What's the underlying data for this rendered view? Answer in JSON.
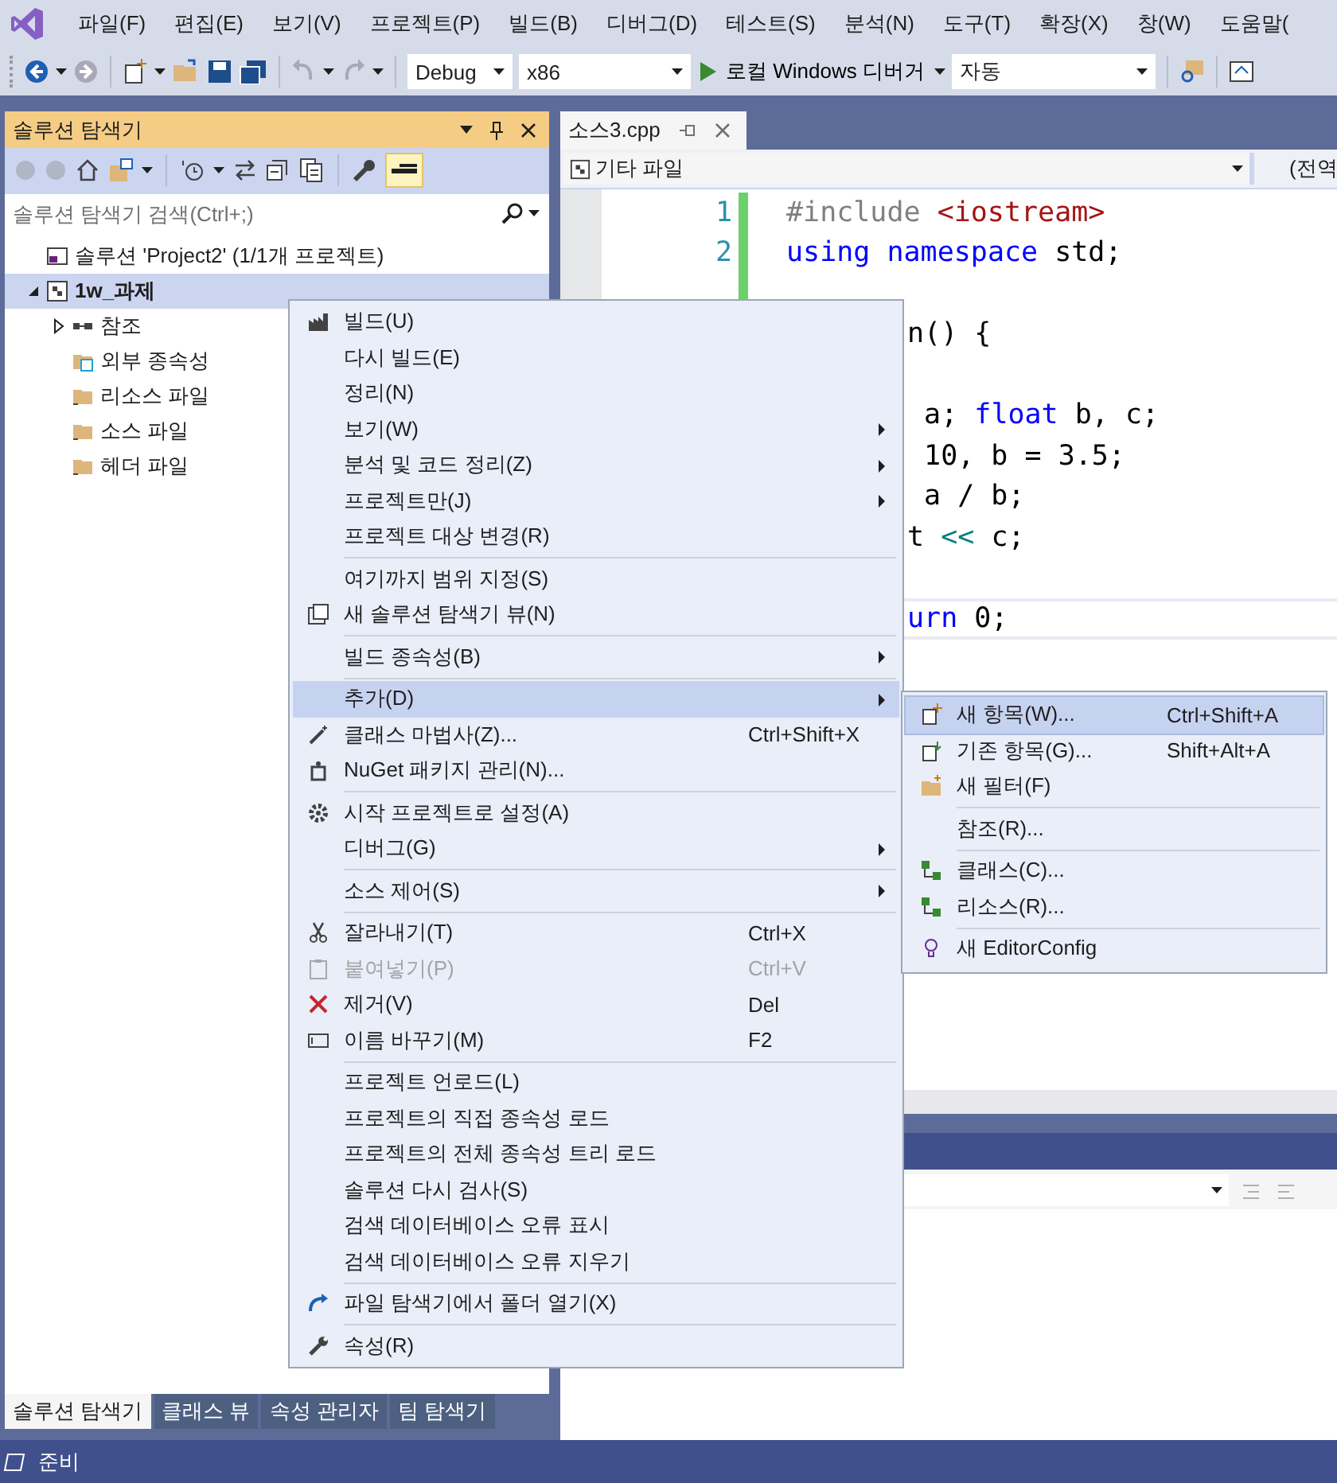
{
  "menu_bar": {
    "items": [
      "파일(F)",
      "편집(E)",
      "보기(V)",
      "프로젝트(P)",
      "빌드(B)",
      "디버그(D)",
      "테스트(S)",
      "분석(N)",
      "도구(T)",
      "확장(X)",
      "창(W)",
      "도움말("
    ]
  },
  "toolbar": {
    "configuration": "Debug",
    "platform": "x86",
    "debugger": "로컬 Windows 디버거",
    "target": "자동"
  },
  "solution_explorer": {
    "title": "솔루션 탐색기",
    "search": {
      "placeholder": "솔루션 탐색기 검색(Ctrl+;)"
    },
    "tree": [
      {
        "label": "솔루션 'Project2' (1/1개 프로젝트)",
        "selected": false,
        "children": [
          {
            "label": "1w_과제",
            "selected": true,
            "expanded": true,
            "children": [
              {
                "label": "참조",
                "selected": false,
                "expanded": false
              },
              {
                "label": "외부 종속성",
                "selected": false
              },
              {
                "label": "리소스 파일",
                "selected": false
              },
              {
                "label": "소스 파일",
                "selected": false
              },
              {
                "label": "헤더 파일",
                "selected": false
              }
            ]
          }
        ]
      }
    ],
    "bottom_tabs": [
      {
        "label": "솔루션 탐색기",
        "selected": true
      },
      {
        "label": "클래스 뷰",
        "selected": false
      },
      {
        "label": "속성 관리자",
        "selected": false
      },
      {
        "label": "팀 탐색기",
        "selected": false
      }
    ]
  },
  "editor": {
    "tabs": [
      {
        "label": "소스3.cpp",
        "selected": true
      }
    ],
    "nav": {
      "scope": "기타 파일",
      "member": "(전역"
    },
    "lines": [
      {
        "number": "1",
        "changed": true,
        "current": false,
        "tokens": [
          {
            "text": "#include ",
            "kind": "preprocessor"
          },
          {
            "text": "<iostream>",
            "kind": "string"
          }
        ]
      },
      {
        "number": "2",
        "changed": true,
        "current": false,
        "tokens": [
          {
            "text": "using",
            "kind": "keyword"
          },
          {
            "text": " namespace",
            "kind": "keyword"
          },
          {
            "text": " std;",
            "kind": "plain"
          }
        ]
      },
      {
        "changed": true,
        "current": false
      },
      {
        "current": false,
        "tokens": [
          {
            "text": "n() {",
            "kind": "plain"
          }
        ]
      },
      {
        "current": false
      },
      {
        "current": false,
        "tokens": [
          {
            "text": " a; ",
            "kind": "plain"
          },
          {
            "text": "float",
            "kind": "keyword"
          },
          {
            "text": " b, c;",
            "kind": "plain"
          }
        ]
      },
      {
        "current": false,
        "tokens": [
          {
            "text": " 10, b = 3.5;",
            "kind": "plain"
          }
        ]
      },
      {
        "current": false,
        "tokens": [
          {
            "text": " a / b;",
            "kind": "plain"
          }
        ]
      },
      {
        "current": false,
        "tokens": [
          {
            "text": "t ",
            "kind": "plain"
          },
          {
            "text": "<<",
            "kind": "operator"
          },
          {
            "text": " c;",
            "kind": "plain"
          }
        ]
      },
      {
        "current": false
      },
      {
        "current": true,
        "tokens": [
          {
            "text": "urn",
            "kind": "keyword"
          },
          {
            "text": " 0;",
            "kind": "plain"
          }
        ]
      }
    ]
  },
  "context_menu": {
    "groups": [
      [
        {
          "label": "빌드(U)",
          "submenu": false,
          "disabled": false,
          "selected": false
        },
        {
          "label": "다시 빌드(E)",
          "submenu": false,
          "disabled": false,
          "selected": false
        },
        {
          "label": "정리(N)",
          "submenu": false,
          "disabled": false,
          "selected": false
        },
        {
          "label": "보기(W)",
          "submenu": true,
          "disabled": false,
          "selected": false
        },
        {
          "label": "분석 및 코드 정리(Z)",
          "submenu": true,
          "disabled": false,
          "selected": false
        },
        {
          "label": "프로젝트만(J)",
          "submenu": true,
          "disabled": false,
          "selected": false
        },
        {
          "label": "프로젝트 대상 변경(R)",
          "submenu": false,
          "disabled": false,
          "selected": false
        }
      ],
      [
        {
          "label": "여기까지 범위 지정(S)",
          "submenu": false,
          "disabled": false,
          "selected": false
        },
        {
          "label": "새 솔루션 탐색기 뷰(N)",
          "submenu": false,
          "disabled": false,
          "selected": false
        }
      ],
      [
        {
          "label": "빌드 종속성(B)",
          "submenu": true,
          "disabled": false,
          "selected": false
        }
      ],
      [
        {
          "label": "추가(D)",
          "submenu": true,
          "disabled": false,
          "selected": true
        },
        {
          "label": "클래스 마법사(Z)...",
          "shortcut": "Ctrl+Shift+X",
          "submenu": false,
          "disabled": false,
          "selected": false
        },
        {
          "label": "NuGet 패키지 관리(N)...",
          "submenu": false,
          "disabled": false,
          "selected": false
        }
      ],
      [
        {
          "label": "시작 프로젝트로 설정(A)",
          "submenu": false,
          "disabled": false,
          "selected": false
        },
        {
          "label": "디버그(G)",
          "submenu": true,
          "disabled": false,
          "selected": false
        }
      ],
      [
        {
          "label": "소스 제어(S)",
          "submenu": true,
          "disabled": false,
          "selected": false
        }
      ],
      [
        {
          "label": "잘라내기(T)",
          "shortcut": "Ctrl+X",
          "submenu": false,
          "disabled": false,
          "selected": false
        },
        {
          "label": "붙여넣기(P)",
          "shortcut": "Ctrl+V",
          "submenu": false,
          "disabled": true,
          "selected": false
        },
        {
          "label": "제거(V)",
          "shortcut": "Del",
          "submenu": false,
          "disabled": false,
          "selected": false
        },
        {
          "label": "이름 바꾸기(M)",
          "shortcut": "F2",
          "submenu": false,
          "disabled": false,
          "selected": false
        }
      ],
      [
        {
          "label": "프로젝트 언로드(L)",
          "submenu": false,
          "disabled": false,
          "selected": false
        },
        {
          "label": "프로젝트의 직접 종속성 로드",
          "submenu": false,
          "disabled": false,
          "selected": false
        },
        {
          "label": "프로젝트의 전체 종속성 트리 로드",
          "submenu": false,
          "disabled": false,
          "selected": false
        },
        {
          "label": "솔루션 다시 검사(S)",
          "submenu": false,
          "disabled": false,
          "selected": false
        },
        {
          "label": "검색 데이터베이스 오류 표시",
          "submenu": false,
          "disabled": false,
          "selected": false
        },
        {
          "label": "검색 데이터베이스 오류 지우기",
          "submenu": false,
          "disabled": false,
          "selected": false
        }
      ],
      [
        {
          "label": "파일 탐색기에서 폴더 열기(X)",
          "submenu": false,
          "disabled": false,
          "selected": false
        }
      ],
      [
        {
          "label": "속성(R)",
          "submenu": false,
          "disabled": false,
          "selected": false
        }
      ]
    ]
  },
  "submenu": {
    "groups": [
      [
        {
          "label": "새 항목(W)...",
          "shortcut": "Ctrl+Shift+A",
          "selected": true
        },
        {
          "label": "기존 항목(G)...",
          "shortcut": "Shift+Alt+A",
          "selected": false
        },
        {
          "label": "새 필터(F)",
          "selected": false
        }
      ],
      [
        {
          "label": "참조(R)...",
          "selected": false
        }
      ],
      [
        {
          "label": "클래스(C)...",
          "selected": false
        },
        {
          "label": "리소스(R)...",
          "selected": false
        }
      ],
      [
        {
          "label": "새 EditorConfig",
          "selected": false
        }
      ]
    ]
  },
  "status_bar": {
    "text": "준비"
  }
}
